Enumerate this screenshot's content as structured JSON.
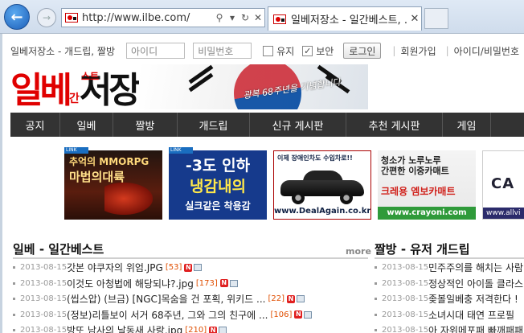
{
  "browser": {
    "url": "http://www.ilbe.com/",
    "tab_title": "일베저장소 - 일간베스트, ..."
  },
  "topbar": {
    "site_title": "일베저장소 - 개드립, 짤방",
    "id_placeholder": "아이디",
    "pw_placeholder": "비밀번호",
    "keep_label": "유지",
    "secure_label": "보안",
    "secure_checked": true,
    "login_label": "로그인",
    "signup_label": "회원가입",
    "find_label": "아이디/비밀번호"
  },
  "logo": {
    "part1": "일베",
    "part2": "간",
    "st": "스트",
    "part3": "저장소",
    "banner_slogan": "광복 68주년을 기념합니다",
    "red": "#e00000"
  },
  "nav": {
    "items": [
      "공지",
      "일베",
      "짤방",
      "개드립",
      "신규 게시판",
      "추천 게시판",
      "게임"
    ]
  },
  "ads": {
    "tag": "LINK",
    "ad1": {
      "top": "추억의 MMORPG",
      "main": "마법의대륙"
    },
    "ad2": {
      "line1": "-3도 인하",
      "line2": "냉감내의",
      "line3": "실크같은 착용감"
    },
    "ad3": {
      "top": "이제 장애인차도 수입차로!!",
      "url": "www.DealAgain.co.kr"
    },
    "ad4": {
      "line1": "청소가 노루노루",
      "line2": "간편한 이중카매트",
      "mid": "크레용 엠보카매트",
      "url": "www.crayoni.com"
    },
    "ad5": {
      "brand": "CA",
      "url": "www.allvi"
    }
  },
  "board_left": {
    "title": "일베 - 일간베스트",
    "more": "more",
    "rows": [
      {
        "date": "2013-08-15",
        "title": "갓본 야쿠자의 위엄.JPG",
        "count": "[53]"
      },
      {
        "date": "2013-08-15",
        "title": "이것도 아청법에 해당되냐?.jpg",
        "count": "[173]"
      },
      {
        "date": "2013-08-15",
        "title": "(씹스압) (브금) [NGC]목숨을 건 포획, 위키드 ...",
        "count": "[22]"
      },
      {
        "date": "2013-08-15",
        "title": "(정보)리틀보이 서거 68주년, 그와 그의 친구에 ...",
        "count": "[106]"
      },
      {
        "date": "2013-08-15",
        "title": "방또 남사의 날동새 사랑.jpg",
        "count": "[210]"
      }
    ]
  },
  "board_right": {
    "title": "짤방 - 유저 개드립",
    "rows": [
      {
        "date": "2013-08-15",
        "title": "민주주의를 해치는 사람"
      },
      {
        "date": "2013-08-15",
        "title": "정상적인 아이돌 클라스"
      },
      {
        "date": "2013-08-15",
        "title": "좆볼일베충 저격한다 !"
      },
      {
        "date": "2013-08-15",
        "title": "소녀시대 태연 프로필"
      },
      {
        "date": "2013-08-15",
        "title": "아 자위메포패 빠깨패패"
      }
    ]
  }
}
